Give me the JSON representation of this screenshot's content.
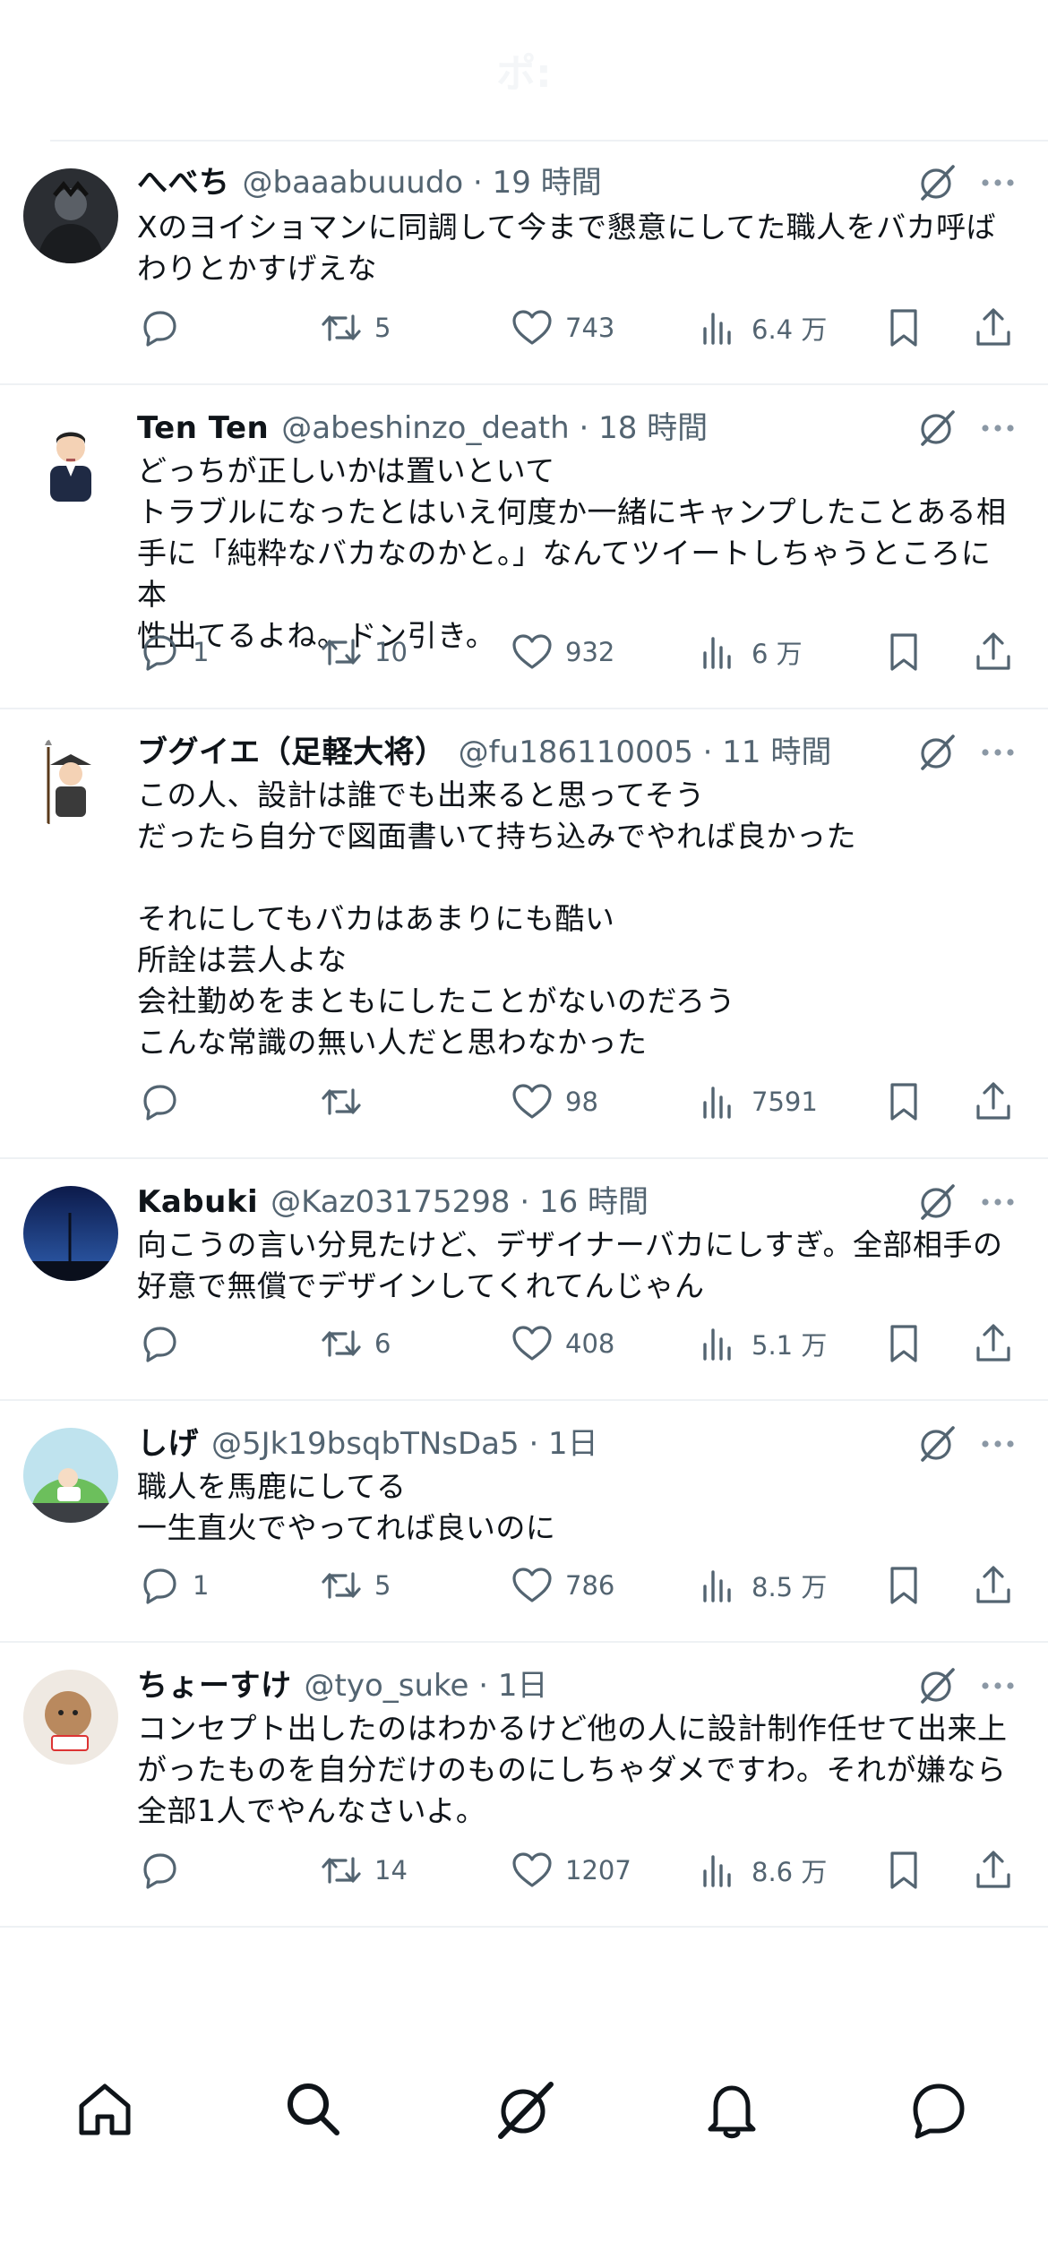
{
  "top_bar": {
    "faded_title": "ポ:"
  },
  "tweets": [
    {
      "name": "へべち",
      "meta": "@baaabuuudo · 19 時間",
      "text": "Xのヨイショマンに同調して今まで懇意にしてた職人をバカ呼ば\nわりとかすげえな",
      "reply": "",
      "retweet": "5",
      "like": "743",
      "views": "6.4 万"
    },
    {
      "name": "Ten Ten",
      "meta": "@abeshinzo_death · 18 時間",
      "text": "どっちが正しいかは置いといて\nトラブルになったとはいえ何度か一緒にキャンプしたことある相\n手に「純粋なバカなのかと。」なんてツイートしちゃうところに本\n性出てるよね。ドン引き。",
      "reply": "1",
      "retweet": "10",
      "like": "932",
      "views": "6 万"
    },
    {
      "name": "ブグイエ（足軽大将）",
      "meta": "@fu186110005 · 11 時間",
      "text": "この人、設計は誰でも出来ると思ってそう\nだったら自分で図面書いて持ち込みでやれば良かった\n\nそれにしてもバカはあまりにも酷い\n所詮は芸人よな\n会社勤めをまともにしたことがないのだろう\nこんな常識の無い人だと思わなかった",
      "reply": "",
      "retweet": "",
      "like": "98",
      "views": "7591"
    },
    {
      "name": "Kabuki",
      "meta": "@Kaz03175298 · 16 時間",
      "text": "向こうの言い分見たけど、デザイナーバカにしすぎ。全部相手の\n好意で無償でデザインしてくれてんじゃん",
      "reply": "",
      "retweet": "6",
      "like": "408",
      "views": "5.1 万"
    },
    {
      "name": "しげ",
      "meta": "@5Jk19bsqbTNsDa5 · 1日",
      "text": "職人を馬鹿にしてる\n一生直火でやってれば良いのに",
      "reply": "1",
      "retweet": "5",
      "like": "786",
      "views": "8.5 万"
    },
    {
      "name": "ちょーすけ",
      "meta": "@tyo_suke · 1日",
      "text": "コンセプト出したのはわかるけど他の人に設計制作任せて出来上\nがったものを自分だけのものにしちゃダメですわ。それが嫌なら\n全部1人でやんなさいよ。",
      "reply": "",
      "retweet": "14",
      "like": "1207",
      "views": "8.6 万"
    }
  ],
  "icons": {
    "grok": "grok-icon",
    "more": "more-dots-icon",
    "reply": "reply-bubble-icon",
    "retweet": "retweet-icon",
    "like": "heart-icon",
    "views": "views-bar-icon",
    "bookmark": "bookmark-icon",
    "share": "share-icon"
  },
  "tab_bar": [
    "home-icon",
    "search-icon",
    "grok-icon",
    "notifications-icon",
    "messages-icon"
  ],
  "colors": {
    "text": "#0f1419",
    "muted": "#536471",
    "divider": "#eef1f4"
  }
}
